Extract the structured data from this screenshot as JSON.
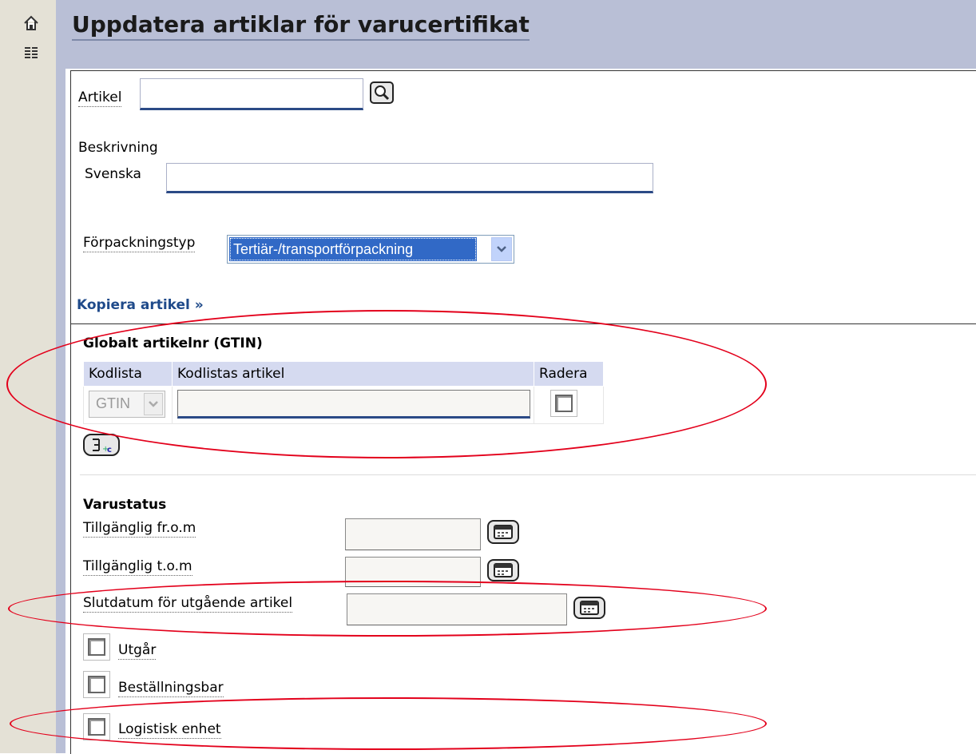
{
  "page": {
    "title": "Uppdatera artiklar för varucertifikat"
  },
  "form": {
    "artikel_label": "Artikel",
    "artikel_value": "",
    "beskrivning_label": "Beskrivning",
    "svenska_label": "Svenska",
    "svenska_value": "",
    "forpackningstyp_label": "Förpackningstyp",
    "forpackningstyp_selected": "Tertiär-/transportförpackning",
    "kopiera_link": "Kopiera artikel »"
  },
  "gtin": {
    "heading": "Globalt artikelnr (GTIN)",
    "columns": [
      "Kodlista",
      "Kodlistas artikel",
      "Radera"
    ],
    "row": {
      "kodlista": "GTIN",
      "artikel": "",
      "radera": false
    }
  },
  "varustatus": {
    "heading": "Varustatus",
    "fields": [
      {
        "label": "Tillgänglig fr.o.m",
        "value": ""
      },
      {
        "label": "Tillgänglig t.o.m",
        "value": ""
      },
      {
        "label": "Slutdatum för utgående artikel",
        "value": ""
      }
    ],
    "checkboxes": [
      {
        "label": "Utgår",
        "checked": false
      },
      {
        "label": "Beställningsbar",
        "checked": false
      },
      {
        "label": "Logistisk enhet",
        "checked": false
      }
    ]
  },
  "colors": {
    "header_bg": "#b9bfd6",
    "link": "#1f4a8a",
    "highlight": "#e3001b",
    "select_bg": "#3169c6"
  }
}
